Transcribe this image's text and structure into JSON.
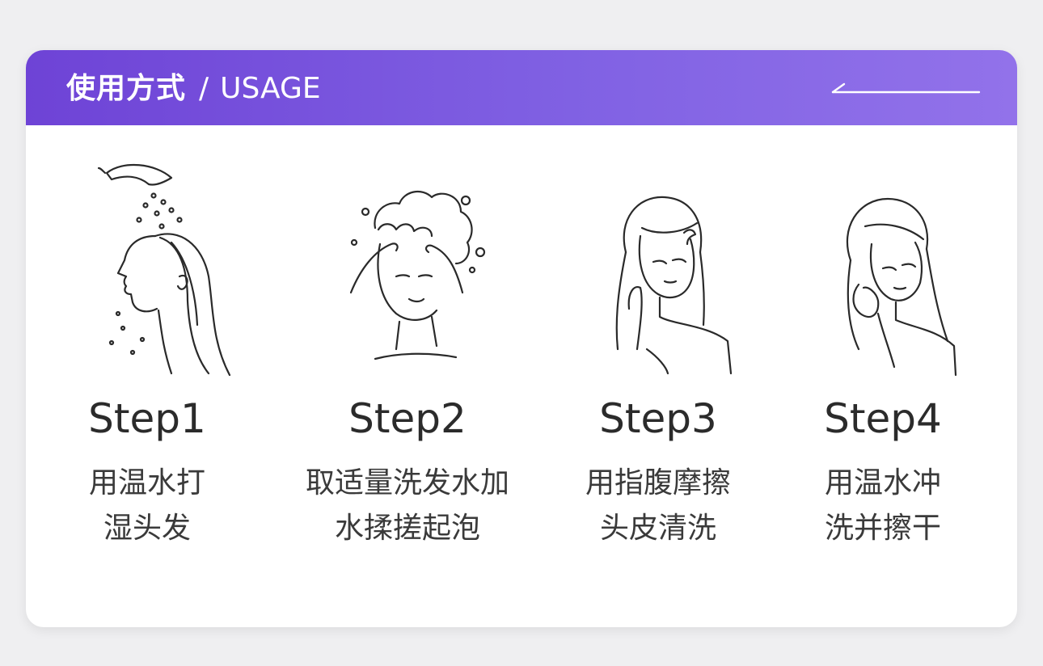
{
  "header": {
    "title_zh": "使用方式",
    "separator": "/",
    "title_en": "USAGE",
    "arrow_icon": "left-arrow-icon"
  },
  "colors": {
    "header_gradient_start": "#6e43d6",
    "header_gradient_end": "#9272ea",
    "background": "#efeff1",
    "card": "#ffffff"
  },
  "steps": [
    {
      "label": "Step1",
      "desc_line1": "用温水打",
      "desc_line2": "湿头发",
      "icon": "shower-wet-hair-icon"
    },
    {
      "label": "Step2",
      "desc_line1": "取适量洗发水加",
      "desc_line2": "水揉搓起泡",
      "icon": "lather-shampoo-icon"
    },
    {
      "label": "Step3",
      "desc_line1": "用指腹摩擦",
      "desc_line2": "头皮清洗",
      "icon": "scalp-massage-icon"
    },
    {
      "label": "Step4",
      "desc_line1": "用温水冲",
      "desc_line2": "洗并擦干",
      "icon": "rinse-dry-icon"
    }
  ]
}
